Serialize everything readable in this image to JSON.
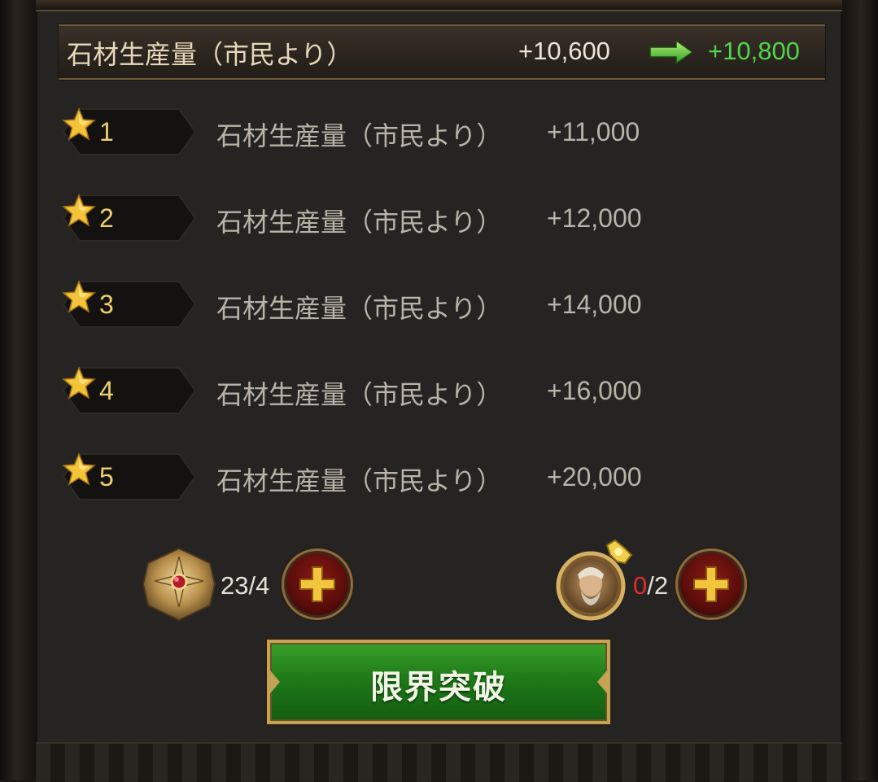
{
  "header": {
    "label": "石材生産量（市民より）",
    "current_value": "+10,600",
    "next_value": "+10,800"
  },
  "star_levels": [
    {
      "stars": "1",
      "label": "石材生産量（市民より）",
      "value": "+11,000"
    },
    {
      "stars": "2",
      "label": "石材生産量（市民より）",
      "value": "+12,000"
    },
    {
      "stars": "3",
      "label": "石材生産量（市民より）",
      "value": "+14,000"
    },
    {
      "stars": "4",
      "label": "石材生産量（市民より）",
      "value": "+16,000"
    },
    {
      "stars": "5",
      "label": "石材生産量（市民より）",
      "value": "+20,000"
    }
  ],
  "resources": {
    "medal": {
      "count": "23/4",
      "icon": "medal-icon"
    },
    "portrait": {
      "owned": "0",
      "required": "/2",
      "icon": "hero-portrait-icon"
    }
  },
  "limit_break_button": {
    "label": "限界突破"
  },
  "colors": {
    "accent_green": "#4fd64a",
    "gold": "#efcf6a",
    "shortage_red": "#e42a2a"
  }
}
